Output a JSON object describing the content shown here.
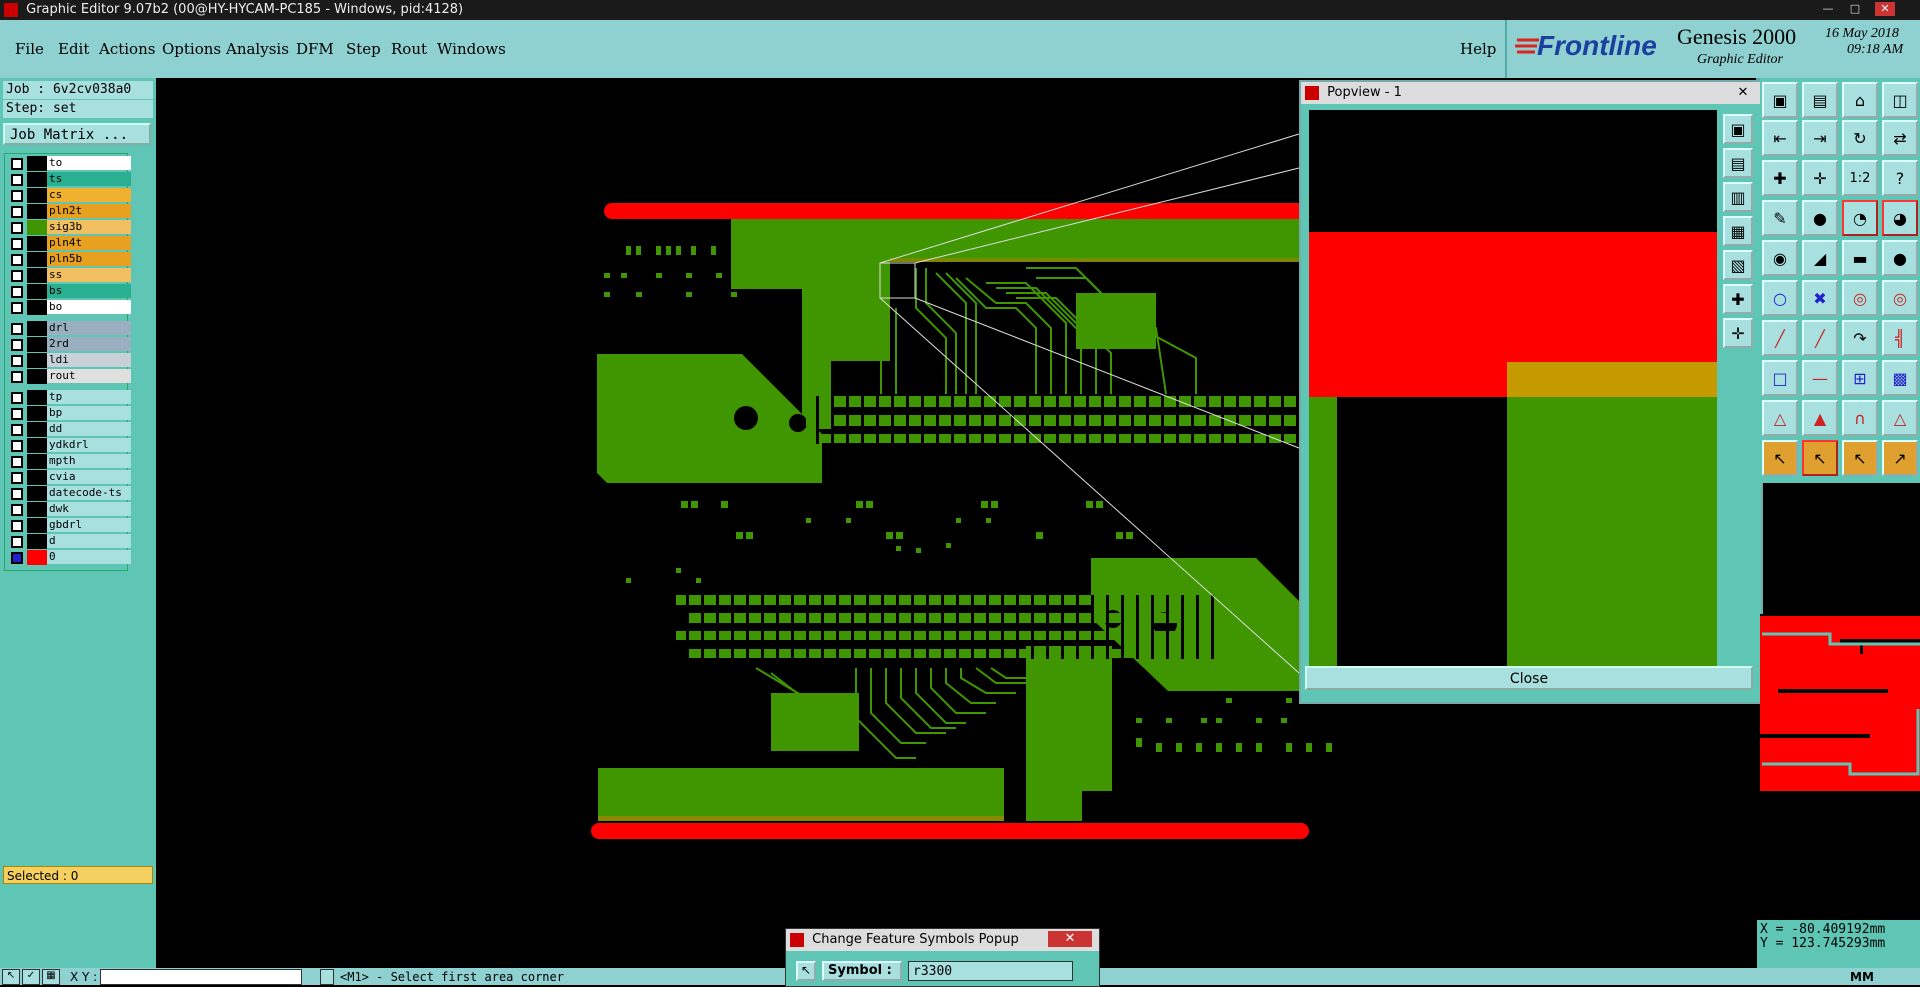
{
  "window": {
    "title": "Graphic Editor 9.07b2 (00@HY-HYCAM-PC185 - Windows, pid:4128)"
  },
  "menu": {
    "file": "File",
    "edit": "Edit",
    "actions": "Actions",
    "options": "Options",
    "analysis": "Analysis",
    "dfm": "DFM",
    "step": "Step",
    "rout": "Rout",
    "windows": "Windows",
    "help": "Help"
  },
  "brand": {
    "logo": "Frontline",
    "product": "Genesis 2000",
    "subtitle": "Graphic Editor",
    "date": "16 May 2018",
    "time": "09:18 AM"
  },
  "job": {
    "job_line": "Job : 6v2cv038a0",
    "step_line": "Step: set",
    "matrix_button": "Job Matrix ..."
  },
  "layers": [
    {
      "name": "to",
      "color": "#ffffff"
    },
    {
      "name": "ts",
      "color": "#2ab090"
    },
    {
      "name": "cs",
      "color": "#f0b030"
    },
    {
      "name": "pln2t",
      "color": "#e8a020"
    },
    {
      "name": "sig3b",
      "color": "#f0c060",
      "active": true
    },
    {
      "name": "pln4t",
      "color": "#e8a020"
    },
    {
      "name": "pln5b",
      "color": "#e8a020"
    },
    {
      "name": "ss",
      "color": "#f0c060"
    },
    {
      "name": "bs",
      "color": "#2ab090"
    },
    {
      "name": "bo",
      "color": "#ffffff"
    },
    {
      "name": "drl",
      "color": "#9ab0c0"
    },
    {
      "name": "2rd",
      "color": "#9ab0c0"
    },
    {
      "name": "ldi",
      "color": "#c8d0d8"
    },
    {
      "name": "rout",
      "color": "#e0e0e0"
    },
    {
      "name": "tp",
      "color": "#a8e0e0"
    },
    {
      "name": "bp",
      "color": "#a8e0e0"
    },
    {
      "name": "dd",
      "color": "#a8e0e0"
    },
    {
      "name": "ydkdrl",
      "color": "#a8e0e0"
    },
    {
      "name": "mpth",
      "color": "#a8e0e0"
    },
    {
      "name": "cvia",
      "color": "#a8e0e0"
    },
    {
      "name": "datecode-ts",
      "color": "#a8e0e0"
    },
    {
      "name": "dwk",
      "color": "#a8e0e0"
    },
    {
      "name": "gbdrl",
      "color": "#a8e0e0"
    },
    {
      "name": "d",
      "color": "#a8e0e0"
    },
    {
      "name": "0",
      "color": "#a8e0e0"
    }
  ],
  "selected": "Selected : 0",
  "status": {
    "xy_label": "X Y :",
    "prompt": "<M1> - Select first area corner"
  },
  "popview": {
    "title": "Popview - 1",
    "close_label": "Close"
  },
  "coords": {
    "x": "X = -80.409192mm",
    "y": "Y = 123.745293mm",
    "units": "MM"
  },
  "popup": {
    "title": "Change Feature Symbols Popup",
    "symbol_label": "Symbol :",
    "symbol_value": "r3300"
  },
  "colors": {
    "panel": "#5fc6b5",
    "menubar": "#8fd0d0",
    "copper": "#3f9600",
    "profile": "#ff0000",
    "amber": "#c49a00"
  }
}
